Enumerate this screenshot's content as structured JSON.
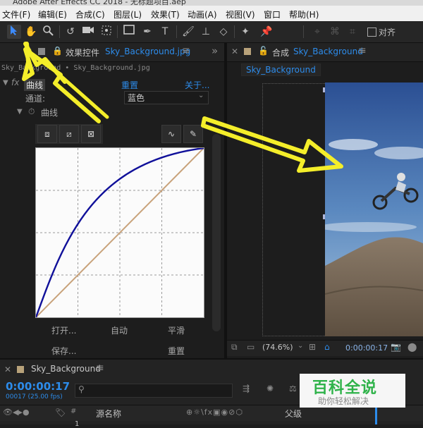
{
  "window": {
    "title": "Adobe After Effects CC 2018 - 无标题项目.aep"
  },
  "menu": [
    "文件(F)",
    "编辑(E)",
    "合成(C)",
    "图层(L)",
    "效果(T)",
    "动画(A)",
    "视图(V)",
    "窗口",
    "帮助(H)"
  ],
  "toolbar": {
    "snap_label": "对齐"
  },
  "effect_panel": {
    "tab_prefix": "效果控件",
    "tab_file": "Sky_Background.jpg",
    "breadcrumb": "Sky_Background • Sky_Background.jpg",
    "effect_name": "曲线",
    "reset_label": "重置",
    "about_label": "关于...",
    "channel_label": "通道:",
    "channel_value": "蓝色",
    "curve_group": "曲线",
    "open_button": "打开...",
    "auto_button": "自动",
    "smooth_button": "平滑",
    "save_button": "保存...",
    "reset_button": "重置"
  },
  "comp_panel": {
    "tab_prefix": "合成",
    "tab_name": "Sky_Background",
    "subtab": "Sky_Background",
    "zoom": "(74.6%)",
    "timecode": "0:00:00:17"
  },
  "timeline": {
    "tab_name": "Sky_Background",
    "timecode": "0:00:00:17",
    "frame_info": "00017 (25.00 fps)",
    "search_placeholder": "",
    "col_source": "源名称",
    "col_parent": "父级",
    "layer_num": "1"
  },
  "watermark": {
    "main": "百科全说",
    "sub": "助你轻松解决"
  },
  "colors": {
    "accent": "#2d8ceb",
    "curve_blue": "#10109a",
    "arrow": "#f4ee2a"
  }
}
